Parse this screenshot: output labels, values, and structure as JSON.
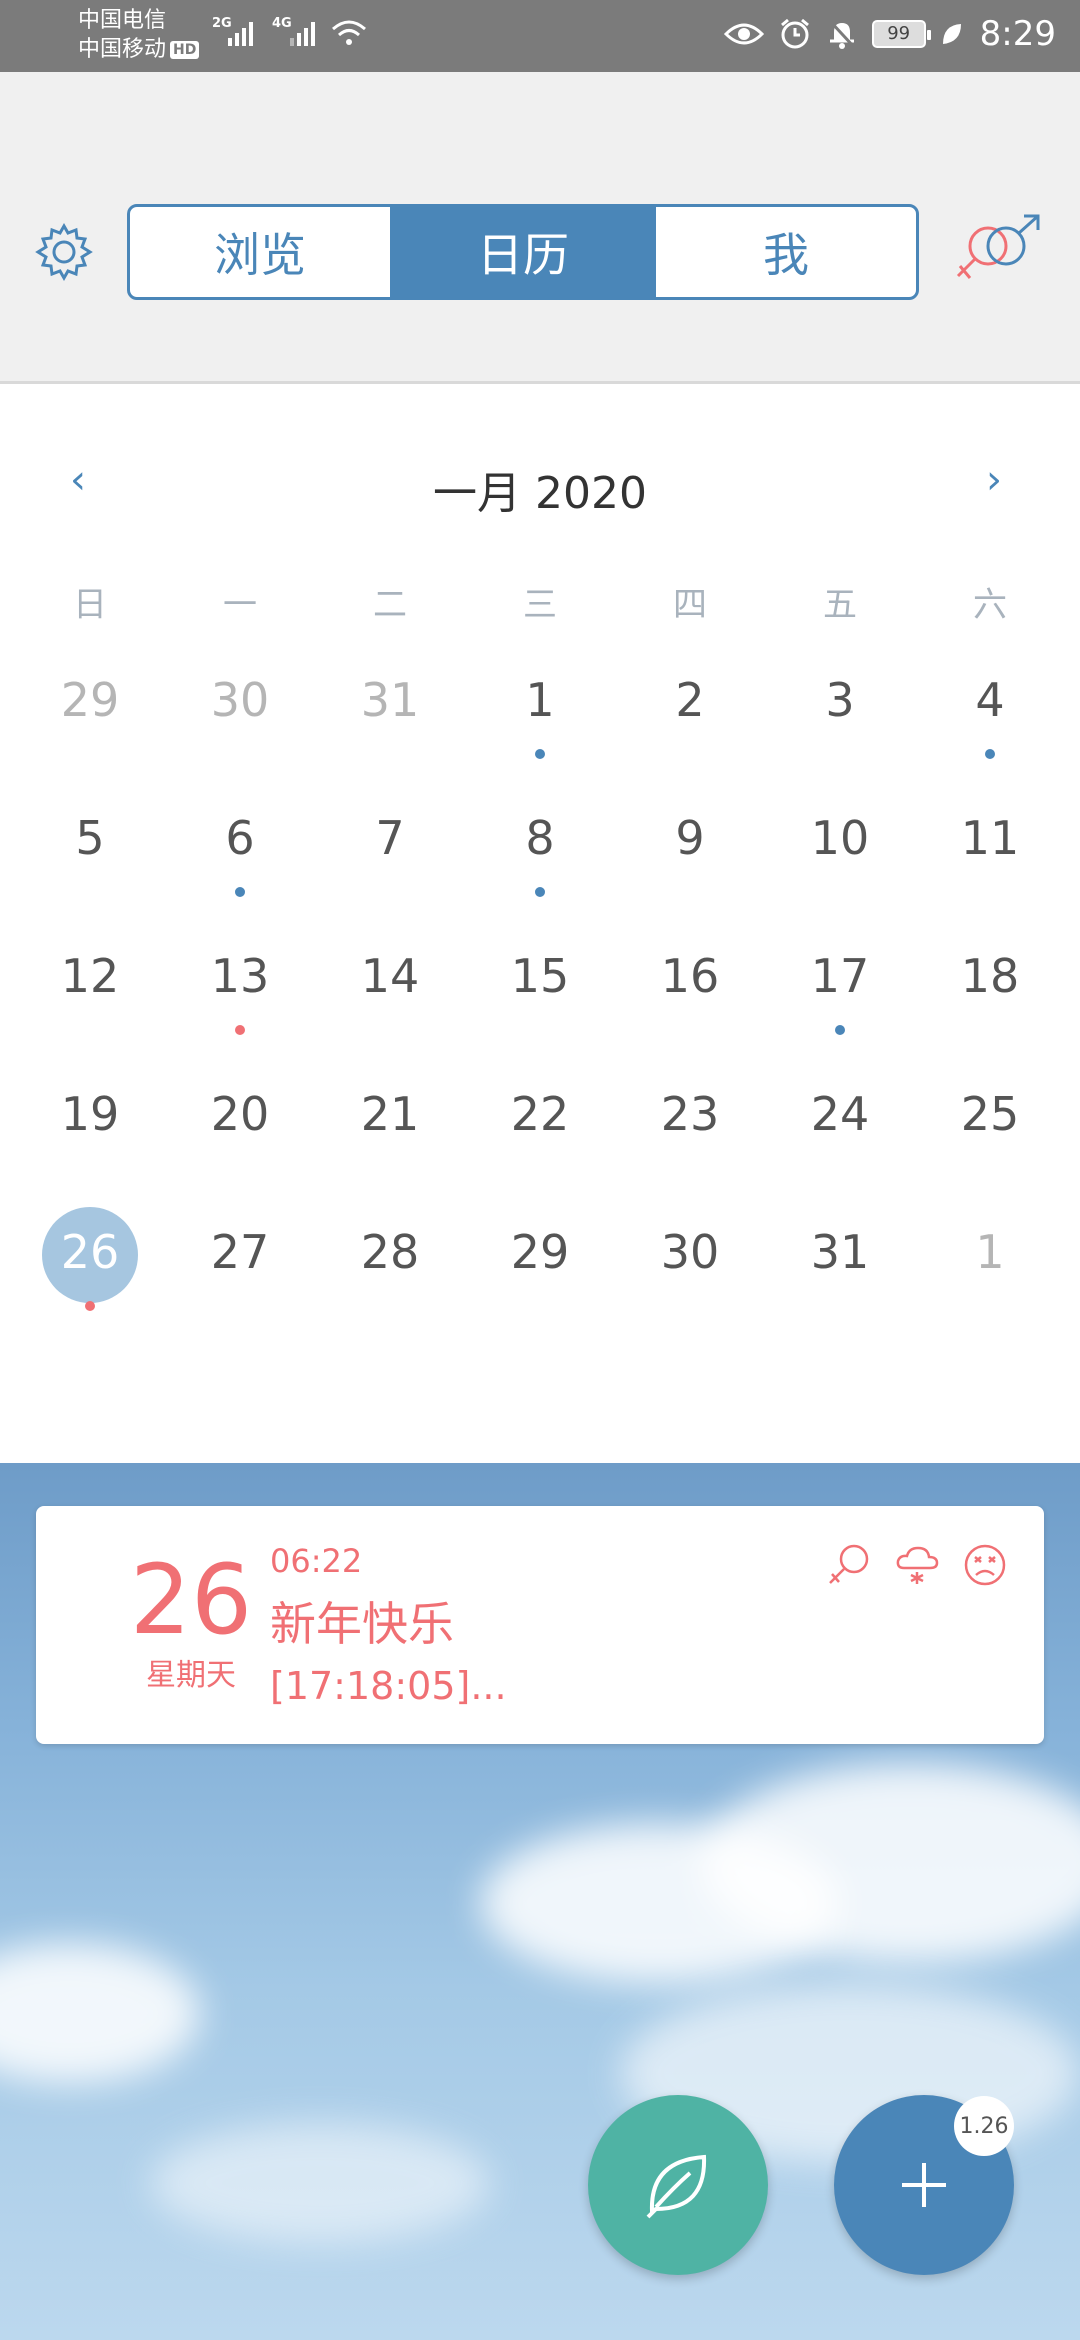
{
  "status_bar": {
    "carrier_1": "中国电信",
    "carrier_2": "中国移动",
    "hd": "HD",
    "net_1": "2G",
    "net_2": "4G",
    "battery": "99",
    "time": "8:29"
  },
  "header": {
    "tabs": [
      {
        "label": "浏览",
        "active": false
      },
      {
        "label": "日历",
        "active": true
      },
      {
        "label": "我",
        "active": false
      }
    ]
  },
  "calendar": {
    "title": "一月 2020",
    "prev": "‹",
    "next": "›",
    "weekdays": [
      "日",
      "一",
      "二",
      "三",
      "四",
      "五",
      "六"
    ],
    "days": [
      {
        "d": "29",
        "other": true
      },
      {
        "d": "30",
        "other": true
      },
      {
        "d": "31",
        "other": true
      },
      {
        "d": "1",
        "dot": "blue"
      },
      {
        "d": "2"
      },
      {
        "d": "3"
      },
      {
        "d": "4",
        "dot": "blue"
      },
      {
        "d": "5"
      },
      {
        "d": "6",
        "dot": "blue"
      },
      {
        "d": "7"
      },
      {
        "d": "8",
        "dot": "blue"
      },
      {
        "d": "9"
      },
      {
        "d": "10"
      },
      {
        "d": "11"
      },
      {
        "d": "12"
      },
      {
        "d": "13",
        "dot": "red"
      },
      {
        "d": "14"
      },
      {
        "d": "15"
      },
      {
        "d": "16"
      },
      {
        "d": "17",
        "dot": "blue"
      },
      {
        "d": "18"
      },
      {
        "d": "19"
      },
      {
        "d": "20"
      },
      {
        "d": "21"
      },
      {
        "d": "22"
      },
      {
        "d": "23"
      },
      {
        "d": "24"
      },
      {
        "d": "25"
      },
      {
        "d": "26",
        "today": true,
        "dot": "red"
      },
      {
        "d": "27"
      },
      {
        "d": "28"
      },
      {
        "d": "29"
      },
      {
        "d": "30"
      },
      {
        "d": "31"
      },
      {
        "d": "1",
        "other": true
      }
    ]
  },
  "event_card": {
    "day": "26",
    "weekday": "星期天",
    "time": "06:22",
    "title": "新年快乐",
    "note": "[17:18:05]...",
    "icons": [
      "female-icon",
      "snow-cloud-icon",
      "sad-face-icon"
    ],
    "accent": "#f07074"
  },
  "fab": {
    "badge": "1.26",
    "leaf_color": "#4fb3a4",
    "add_color": "#4a86b8"
  },
  "colors": {
    "primary": "#4a86b8",
    "accent_red": "#f07074",
    "status_bar": "#7b7b7b"
  }
}
